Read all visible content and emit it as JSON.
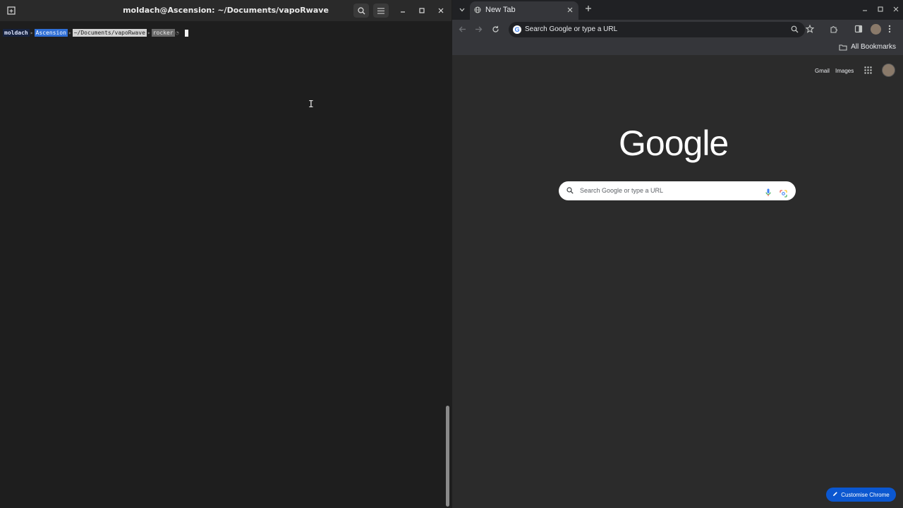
{
  "terminal": {
    "title": "moldach@Ascension: ~/Documents/vapoRwave",
    "prompt": {
      "user": "moldach",
      "host": "Ascension",
      "dir": "~/Documents/vapoRwave",
      "branch": "rocker"
    }
  },
  "browser": {
    "tab_title": "New Tab",
    "omnibox_placeholder": "Search Google or type a URL",
    "bookmarks_label": "All Bookmarks",
    "ntp": {
      "gmail": "Gmail",
      "images": "Images",
      "logo": "Google",
      "search_placeholder": "Search Google or type a URL",
      "customise": "Customise Chrome"
    }
  },
  "colors": {
    "accent": "#0b57d0",
    "host_segment": "#2f6fd6"
  }
}
